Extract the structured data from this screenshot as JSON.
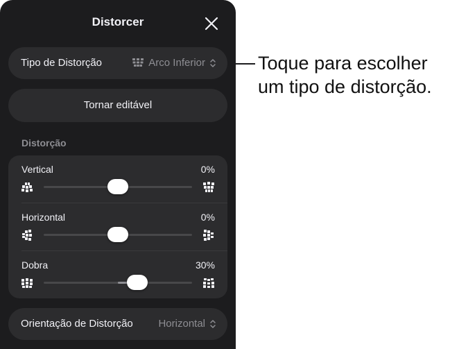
{
  "panel": {
    "title": "Distorcer",
    "close_icon": "close-icon"
  },
  "type_row": {
    "label": "Tipo de Distorção",
    "value": "Arco Inferior",
    "value_icon": "arc-bottom-icon",
    "chevron_icon": "chevron-up-down-icon"
  },
  "make_editable": {
    "label": "Tornar editável"
  },
  "distortion_section": {
    "header": "Distorção",
    "sliders": [
      {
        "label": "Vertical",
        "value": "0%",
        "level": 0.5,
        "fill_from": 0.5,
        "icon_left": "distort-vertical-min-icon",
        "icon_right": "distort-vertical-max-icon"
      },
      {
        "label": "Horizontal",
        "value": "0%",
        "level": 0.5,
        "fill_from": 0.5,
        "icon_left": "distort-horizontal-min-icon",
        "icon_right": "distort-horizontal-max-icon"
      },
      {
        "label": "Dobra",
        "value": "30%",
        "level": 0.63,
        "fill_from": 0.5,
        "icon_left": "bend-min-icon",
        "icon_right": "bend-max-icon"
      }
    ]
  },
  "orientation_row": {
    "label": "Orientação de Distorção",
    "value": "Horizontal",
    "chevron_icon": "chevron-up-down-icon"
  },
  "callout": {
    "line1": "Toque para escolher",
    "line2": "um tipo de distorção."
  },
  "colors": {
    "panel_bg": "#1c1c1e",
    "control_bg": "#2c2c2e",
    "secondary_text": "#8e8e93",
    "primary_text": "#f2f2f7"
  }
}
